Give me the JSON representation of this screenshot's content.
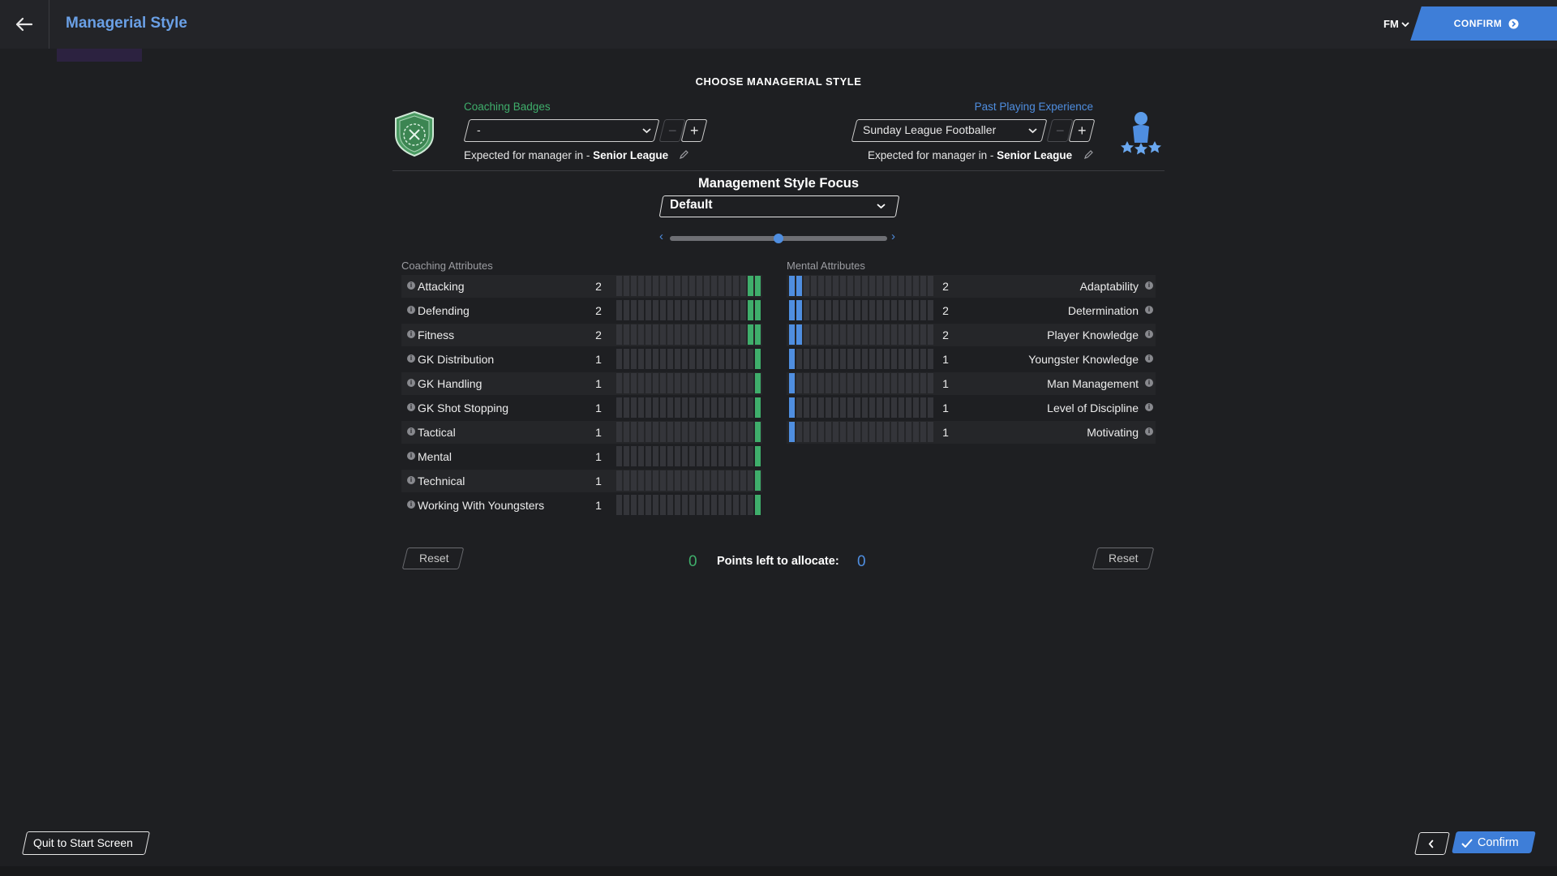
{
  "header": {
    "title": "Managerial Style",
    "fm_menu_label": "FM",
    "confirm_label": "CONFIRM"
  },
  "page_heading": "CHOOSE MANAGERIAL STYLE",
  "coaching_badges": {
    "label": "Coaching Badges",
    "selected": "-",
    "expected_prefix": "Expected for manager in",
    "expected_dash": "-",
    "expected_level": "Senior League"
  },
  "past_playing": {
    "label": "Past Playing Experience",
    "selected": "Sunday League Footballer",
    "expected_prefix": "Expected for manager in",
    "expected_dash": "-",
    "expected_level": "Senior League"
  },
  "focus": {
    "title": "Management Style Focus",
    "selected": "Default",
    "slider_position": 0.5
  },
  "coaching_attributes": {
    "label": "Coaching Attributes",
    "max_points": 20,
    "items": [
      {
        "name": "Attacking",
        "value": 2
      },
      {
        "name": "Defending",
        "value": 2
      },
      {
        "name": "Fitness",
        "value": 2
      },
      {
        "name": "GK Distribution",
        "value": 1
      },
      {
        "name": "GK Handling",
        "value": 1
      },
      {
        "name": "GK Shot Stopping",
        "value": 1
      },
      {
        "name": "Tactical",
        "value": 1
      },
      {
        "name": "Mental",
        "value": 1
      },
      {
        "name": "Technical",
        "value": 1
      },
      {
        "name": "Working With Youngsters",
        "value": 1
      }
    ]
  },
  "mental_attributes": {
    "label": "Mental Attributes",
    "max_points": 20,
    "items": [
      {
        "name": "Adaptability",
        "value": 2
      },
      {
        "name": "Determination",
        "value": 2
      },
      {
        "name": "Player Knowledge",
        "value": 2
      },
      {
        "name": "Youngster Knowledge",
        "value": 1
      },
      {
        "name": "Man Management",
        "value": 1
      },
      {
        "name": "Level of Discipline",
        "value": 1
      },
      {
        "name": "Motivating",
        "value": 1
      }
    ]
  },
  "points": {
    "left_value": "0",
    "label": "Points left to allocate:",
    "right_value": "0",
    "left_color": "#3fae6b",
    "right_color": "#4f8ee0"
  },
  "reset_label": "Reset",
  "footer": {
    "quit_label": "Quit to Start Screen",
    "confirm_label": "Confirm"
  },
  "colors": {
    "accent_blue": "#3e7ed8",
    "coaching_bar": "#3fae6b",
    "mental_bar": "#4f8ee0",
    "empty_bar": "#34353a"
  },
  "icons": {
    "back": "arrow-left-icon",
    "coaching_badge": "shield-whistle-icon",
    "past_playing": "player-stars-icon",
    "info": "info-icon",
    "edit": "pencil-icon"
  }
}
